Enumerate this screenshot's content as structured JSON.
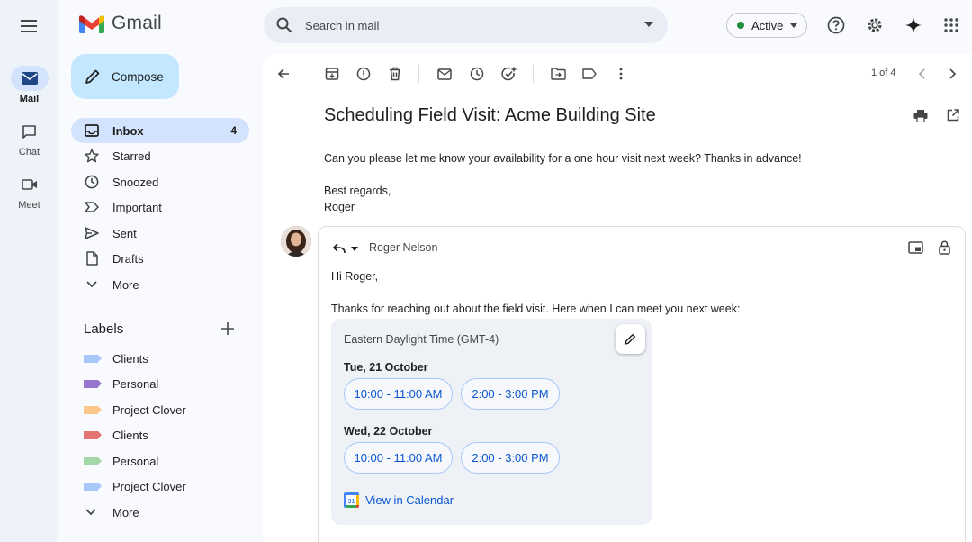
{
  "rail": {
    "items": [
      {
        "label": "Mail"
      },
      {
        "label": "Chat"
      },
      {
        "label": "Meet"
      }
    ]
  },
  "app": {
    "title": "Gmail"
  },
  "search": {
    "placeholder": "Search in mail"
  },
  "status": {
    "label": "Active",
    "color": "#1e8e3e"
  },
  "compose": {
    "label": "Compose"
  },
  "nav": [
    {
      "label": "Inbox",
      "count": "4",
      "icon": "inbox-icon"
    },
    {
      "label": "Starred",
      "icon": "star-icon"
    },
    {
      "label": "Snoozed",
      "icon": "clock-icon"
    },
    {
      "label": "Important",
      "icon": "important-icon"
    },
    {
      "label": "Sent",
      "icon": "send-icon"
    },
    {
      "label": "Drafts",
      "icon": "draft-icon"
    },
    {
      "label": "More",
      "icon": "chevron-down-icon"
    }
  ],
  "labels": {
    "title": "Labels",
    "items": [
      {
        "label": "Clients",
        "color": "#a8c7fa"
      },
      {
        "label": "Personal",
        "color": "#9575cd"
      },
      {
        "label": "Project Clover",
        "color": "#fcc889"
      },
      {
        "label": "Clients",
        "color": "#e57373"
      },
      {
        "label": "Personal",
        "color": "#a5d6a7"
      },
      {
        "label": "Project Clover",
        "color": "#a8c7fa"
      }
    ],
    "more": "More"
  },
  "toolbar": {
    "pager": "1 of 4"
  },
  "email": {
    "subject": "Scheduling Field Visit: Acme Building Site",
    "body": "Can you please let me know your availability for a one hour visit next week? Thanks in advance!",
    "signoff": "Best regards,",
    "signature": "Roger"
  },
  "reply": {
    "to": "Roger Nelson",
    "greeting": "Hi Roger,",
    "intro": "Thanks for reaching out about the field visit. Here when I can meet you next week:",
    "availability": {
      "timezone": "Eastern Daylight Time (GMT-4)",
      "days": [
        {
          "date": "Tue, 21 October",
          "slots": [
            "10:00 - 11:00 AM",
            "2:00 - 3:00 PM"
          ]
        },
        {
          "date": "Wed, 22 October",
          "slots": [
            "10:00 - 11:00 AM",
            "2:00 - 3:00 PM"
          ]
        }
      ],
      "calendar_link": "View in Calendar"
    }
  }
}
